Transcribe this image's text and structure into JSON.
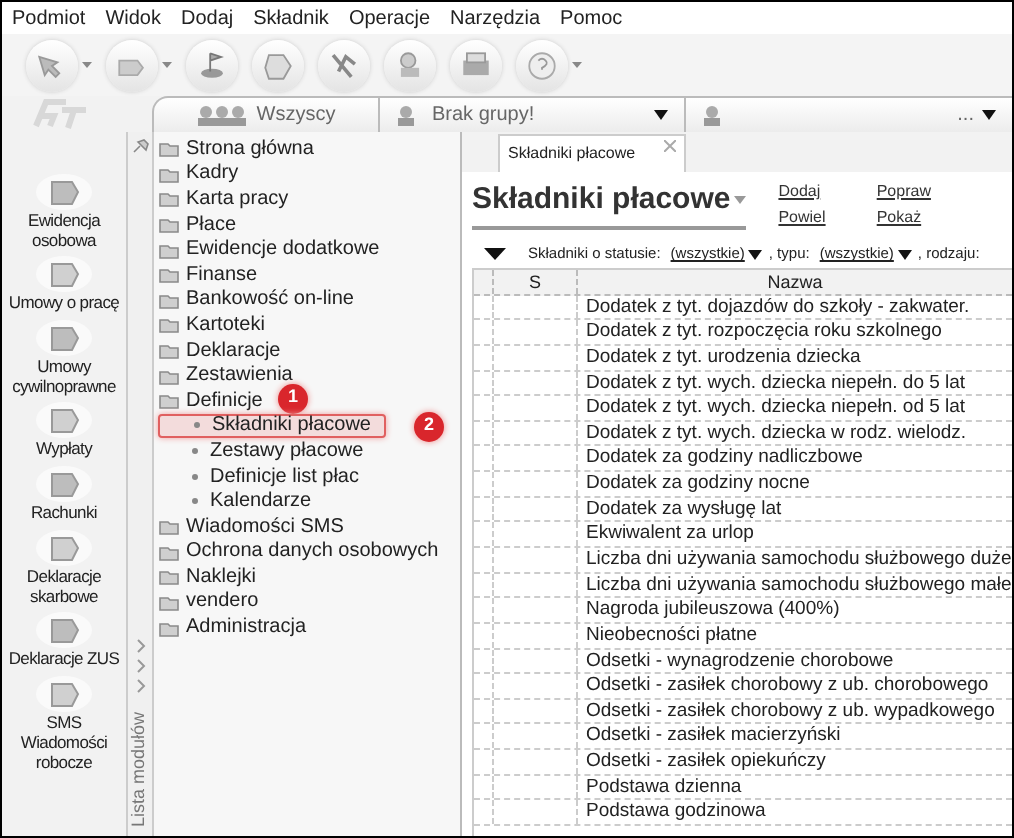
{
  "menu": [
    "Podmiot",
    "Widok",
    "Dodaj",
    "Składnik",
    "Operacje",
    "Narzędzia",
    "Pomoc"
  ],
  "group_bar": [
    {
      "label": "Wszyscy",
      "dropdown": false
    },
    {
      "label": "Brak grupy!",
      "dropdown": true
    },
    {
      "label": "...",
      "dropdown": true
    }
  ],
  "nav": [
    "Ewidencja osobowa",
    "Umowy o pracę",
    "Umowy cywilnoprawne",
    "Wypłaty",
    "Rachunki",
    "Deklaracje skarbowe",
    "Deklaracje ZUS",
    "SMS Wiadomości robocze"
  ],
  "module_strip": "Lista modułów",
  "tree": [
    {
      "label": "Strona główna"
    },
    {
      "label": "Kadry"
    },
    {
      "label": "Karta pracy"
    },
    {
      "label": "Płace"
    },
    {
      "label": "Ewidencje dodatkowe"
    },
    {
      "label": "Finanse"
    },
    {
      "label": "Bankowość on-line"
    },
    {
      "label": "Kartoteki"
    },
    {
      "label": "Deklaracje"
    },
    {
      "label": "Zestawienia"
    },
    {
      "label": "Definicje",
      "badge": "1",
      "children": [
        {
          "label": "Składniki płacowe",
          "selected": true,
          "badge": "2"
        },
        {
          "label": "Zestawy płacowe",
          "selected": false
        },
        {
          "label": "Definicje list płac",
          "selected": false
        },
        {
          "label": "Kalendarze",
          "selected": false
        }
      ]
    },
    {
      "label": "Wiadomości SMS"
    },
    {
      "label": "Ochrona danych osobowych"
    },
    {
      "label": "Naklejki"
    },
    {
      "label": "vendero"
    },
    {
      "label": "Administracja"
    }
  ],
  "doc_tab": {
    "label": "Składniki płacowe"
  },
  "title": "Składniki płacowe",
  "actions": [
    "Dodaj",
    "Popraw",
    "Powiel",
    "Pokaż"
  ],
  "filter": [
    {
      "kind": "text",
      "text": "Składniki o statusie:"
    },
    {
      "kind": "combo",
      "text": "(wszystkie)"
    },
    {
      "kind": "text",
      "text": ", typu:"
    },
    {
      "kind": "combo",
      "text": "(wszystkie)"
    },
    {
      "kind": "text",
      "text": ", rodzaju:"
    }
  ],
  "table": {
    "columns": [
      "S",
      "Nazwa"
    ],
    "rows": [
      "Dodatek z tyt. dojazdów do szkoły - zakwater.",
      "Dodatek z tyt. rozpoczęcia roku szkolnego",
      "Dodatek z tyt. urodzenia dziecka",
      "Dodatek z tyt. wych. dziecka niepełn. do 5 lat",
      "Dodatek z tyt. wych. dziecka niepełn. od 5 lat",
      "Dodatek z tyt. wych. dziecka w rodz. wielodz.",
      "Dodatek za godziny nadliczbowe",
      "Dodatek za godziny nocne",
      "Dodatek za wysługę lat",
      "Ekwiwalent za urlop",
      "Liczba dni używania samochodu służbowego duże",
      "Liczba dni używania samochodu służbowego małe",
      "Nagroda jubileuszowa (400%)",
      "Nieobecności płatne",
      "Odsetki - wynagrodzenie chorobowe",
      "Odsetki - zasiłek chorobowy z ub. chorobowego",
      "Odsetki - zasiłek chorobowy z ub. wypadkowego",
      "Odsetki - zasiłek macierzyński",
      "Odsetki - zasiłek opiekuńczy",
      "Podstawa dzienna",
      "Podstawa godzinowa"
    ]
  }
}
